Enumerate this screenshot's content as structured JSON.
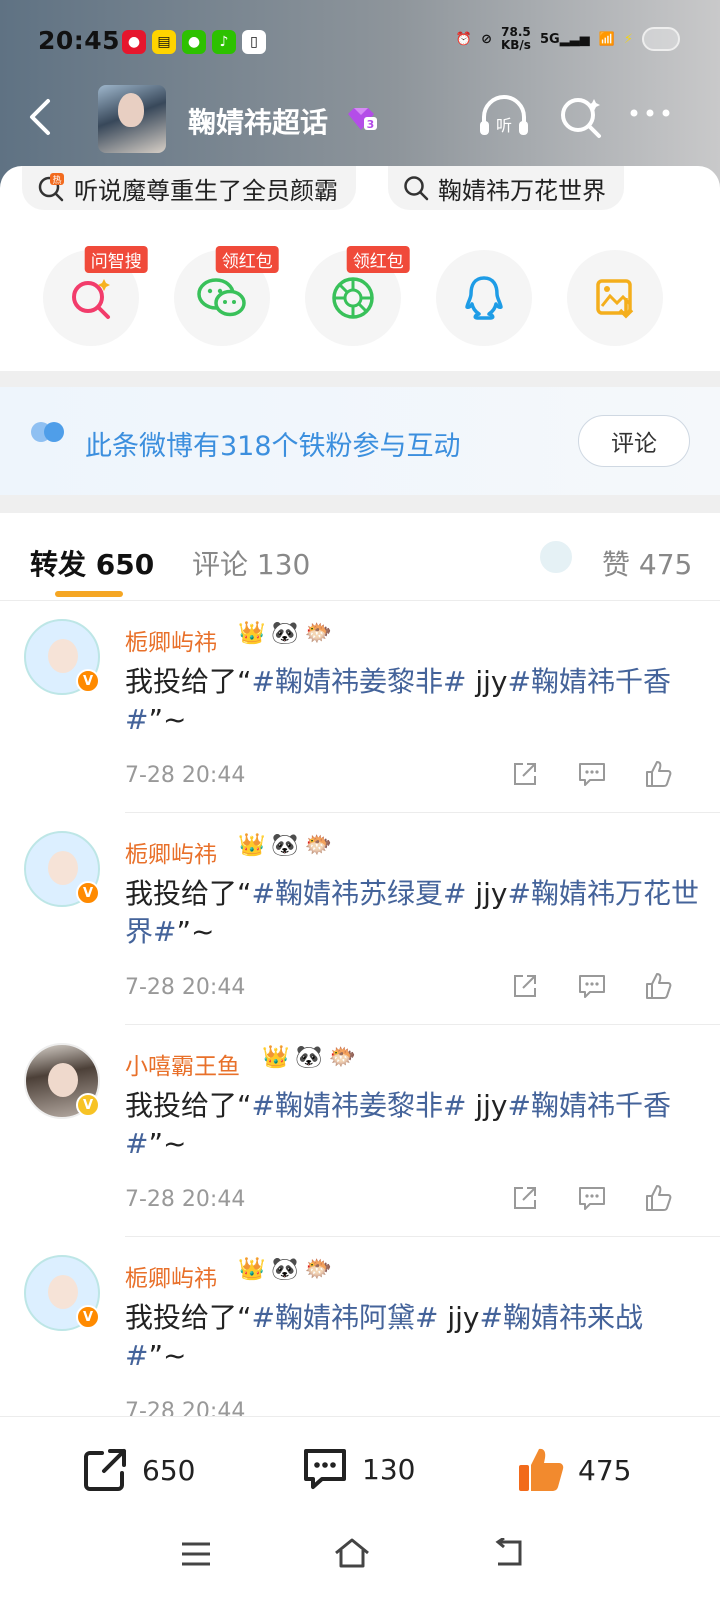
{
  "status_bar": {
    "time": "20:45",
    "net_speed_value": "78.5",
    "net_speed_unit": "KB/s",
    "network": "5G"
  },
  "header": {
    "title": "鞠婧祎超话",
    "level_badge": "3"
  },
  "search_chips": [
    {
      "label": "听说魔尊重生了全员颜霸",
      "badge": "热"
    },
    {
      "label": "鞠婧祎万花世界"
    }
  ],
  "quick_actions": [
    {
      "badge": "问智搜",
      "icon": "search-ai-icon",
      "color": "#f23c6b"
    },
    {
      "badge": "领红包",
      "icon": "wechat-icon",
      "color": "#39c15a"
    },
    {
      "badge": "领红包",
      "icon": "moments-icon",
      "color": "#39c15a"
    },
    {
      "badge": "",
      "icon": "qq-icon",
      "color": "#1e9ce6"
    },
    {
      "badge": "",
      "icon": "save-image-icon",
      "color": "#f4ae1c"
    }
  ],
  "banner": {
    "text": "此条微博有318个铁粉参与互动",
    "button": "评论"
  },
  "tabs": {
    "reposts": "转发 650",
    "comments": "评论 130",
    "likes": "赞 475"
  },
  "reposts": [
    {
      "user": "栀卿屿祎",
      "text_prefix": "我投给了“",
      "tag1": "#鞠婧祎姜黎非#",
      "mid": " jjy",
      "tag2": "#鞠婧祎千香#",
      "suffix": "”~",
      "time": "7-28 20:44"
    },
    {
      "user": "栀卿屿祎",
      "text_prefix": "我投给了“",
      "tag1": "#鞠婧祎苏绿夏#",
      "mid": " jjy",
      "tag2": "#鞠婧祎万花世界#",
      "suffix": "”~",
      "time": "7-28 20:44"
    },
    {
      "user": "小嘻霸王鱼",
      "text_prefix": "我投给了“",
      "tag1": "#鞠婧祎姜黎非#",
      "mid": " jjy",
      "tag2": "#鞠婧祎千香#",
      "suffix": "”~",
      "time": "7-28 20:44"
    },
    {
      "user": "栀卿屿祎",
      "text_prefix": "我投给了“",
      "tag1": "#鞠婧祎阿黛#",
      "mid": " jjy",
      "tag2": "#鞠婧祎来战#",
      "suffix": "”~",
      "time": "7-28 20:44"
    }
  ],
  "bottom_bar": {
    "reposts": "650",
    "comments": "130",
    "likes": "475"
  },
  "colors": {
    "accent_orange": "#f5a623",
    "username": "#e8702a",
    "topic_link": "#44639a",
    "banner_blue": "#3c8fde"
  }
}
